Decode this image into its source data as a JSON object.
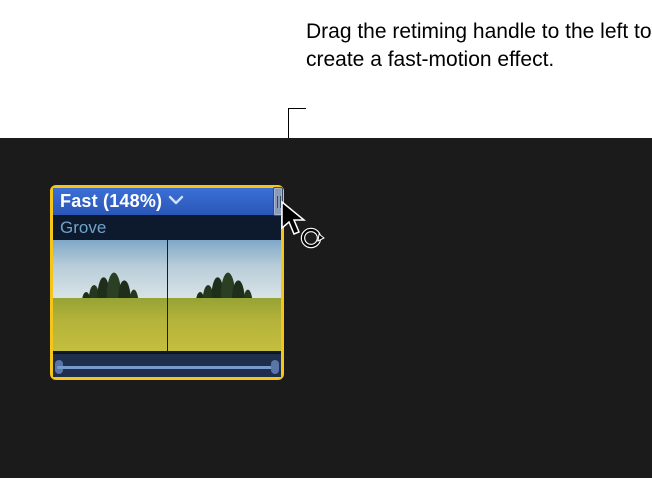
{
  "annotation": {
    "text": "Drag the retiming handle to the left to create a fast-motion effect."
  },
  "clip": {
    "speed_label": "Fast (148%)",
    "name": "Grove",
    "retiming_icon": "chevron-down-icon",
    "handle_name": "retiming-handle",
    "cursor_name": "arrow-cursor",
    "refresh_name": "retime-cursor-icon"
  },
  "colors": {
    "selection": "#f5c518",
    "speedbar": "#2a56b8",
    "timeline_bg": "#1b1b1b"
  }
}
